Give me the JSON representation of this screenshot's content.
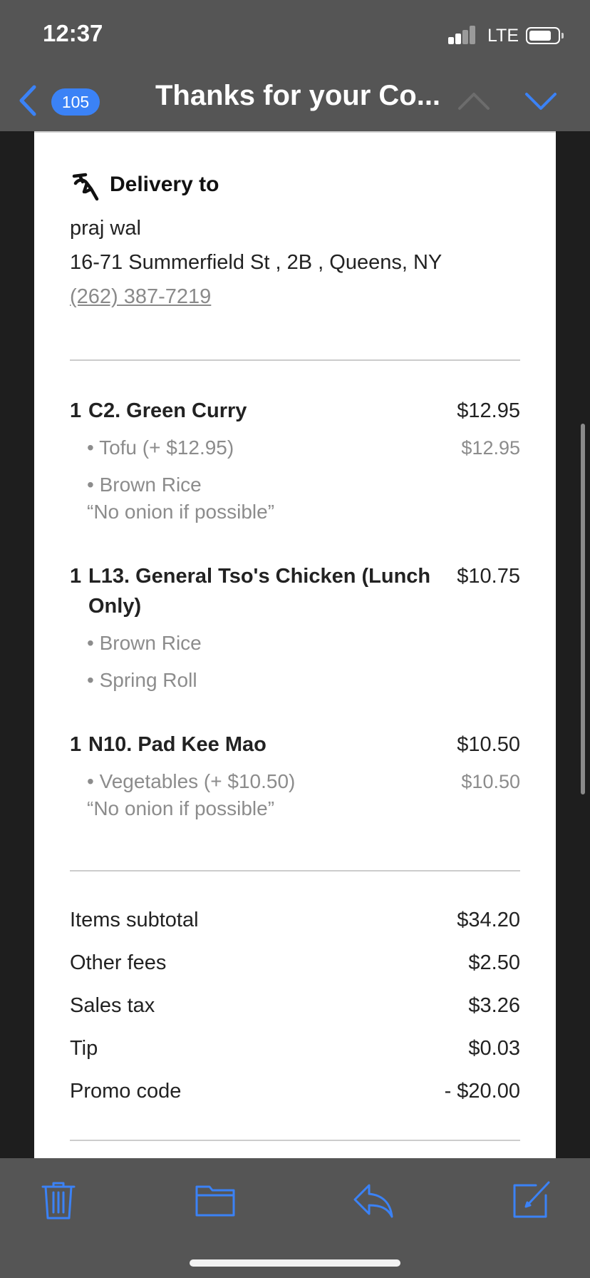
{
  "status_bar": {
    "time": "12:37",
    "network": "LTE"
  },
  "nav": {
    "unread_count": "105",
    "title": "Thanks for your Co...",
    "colors": {
      "accent": "#3b82f6",
      "disabled": "#6c6c6c"
    }
  },
  "delivery": {
    "heading": "Delivery to",
    "name": "praj wal",
    "address": "16-71 Summerfield St , 2B , Queens, NY",
    "phone": "(262) 387-7219"
  },
  "items": [
    {
      "qty": "1",
      "name": "C2. Green Curry",
      "price": "$12.95",
      "options": [
        {
          "text": "• Tofu (+ $12.95)",
          "price": "$12.95"
        },
        {
          "text": "• Brown Rice",
          "price": ""
        }
      ],
      "note": "“No onion if possible”"
    },
    {
      "qty": "1",
      "name": "L13. General Tso's Chicken (Lunch Only)",
      "price": "$10.75",
      "options": [
        {
          "text": "• Brown Rice",
          "price": ""
        },
        {
          "text": "• Spring Roll",
          "price": ""
        }
      ],
      "note": ""
    },
    {
      "qty": "1",
      "name": "N10. Pad Kee Mao",
      "price": "$10.50",
      "options": [
        {
          "text": "• Vegetables (+ $10.50)",
          "price": "$10.50"
        }
      ],
      "note": "“No onion if possible”"
    }
  ],
  "summary": [
    {
      "label": "Items subtotal",
      "value": "$34.20"
    },
    {
      "label": "Other fees",
      "value": "$2.50"
    },
    {
      "label": "Sales tax",
      "value": "$3.26"
    },
    {
      "label": "Tip",
      "value": "$0.03"
    },
    {
      "label": "Promo code",
      "value": "- $20.00"
    }
  ],
  "toolbar": {
    "icons": [
      "trash-icon",
      "folder-icon",
      "reply-icon",
      "compose-icon"
    ]
  }
}
